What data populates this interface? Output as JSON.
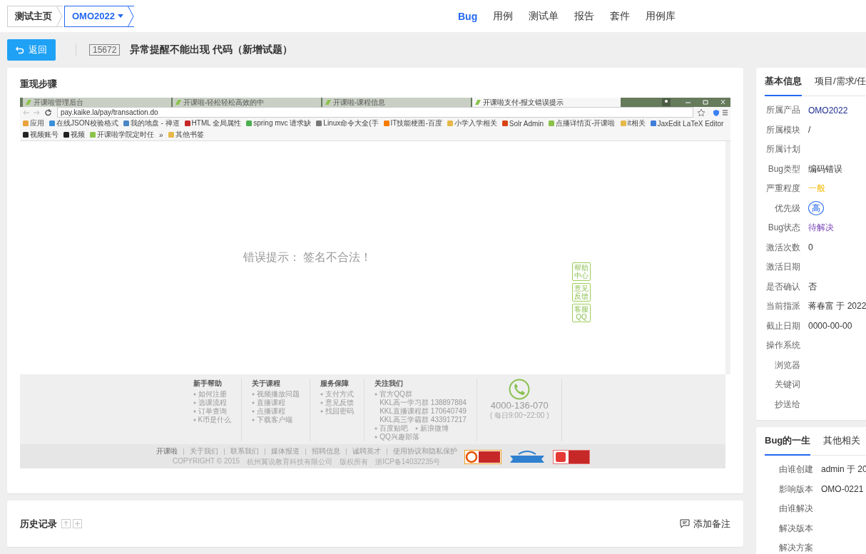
{
  "breadcrumb": [
    {
      "label": "测试主页",
      "selected": false
    },
    {
      "label": "OMO2022",
      "selected": true
    }
  ],
  "nav": [
    {
      "label": "Bug",
      "selected": true
    },
    {
      "label": "用例",
      "selected": false
    },
    {
      "label": "测试单",
      "selected": false
    },
    {
      "label": "报告",
      "selected": false
    },
    {
      "label": "套件",
      "selected": false
    },
    {
      "label": "用例库",
      "selected": false
    }
  ],
  "header": {
    "back_button": "返回",
    "bug_id": "15672",
    "title": "异常提醒不能出现 代码（新增试题）"
  },
  "steps": {
    "title": "重现步骤",
    "screenshot": {
      "tabs": [
        {
          "title": "开课啦管理后台",
          "selected": false
        },
        {
          "title": "开课啦-轻松轻松高效的中",
          "selected": false
        },
        {
          "title": "开课啦-课程信息",
          "selected": false
        },
        {
          "title": "开课啦支付-报文错误提示",
          "selected": true
        }
      ],
      "url": "pay.kaike.la/pay/transaction.do",
      "bookmarks": [
        "应用",
        "在线JSON校验格式",
        "我的地盘 - 禅道",
        "HTML 全局属性",
        "spring mvc 请求缺",
        "Linux命令大全(手",
        "IT技能梗图-百度",
        "小学入学相关",
        "Solr Admin",
        "点播详情页-开课啦",
        "it相关",
        "JaxEdit LaTeX Editor",
        "视频账号",
        "视频",
        "开课啦学院定时任",
        "»",
        "其他书签"
      ],
      "error_text": "错误提示： 签名不合法！",
      "side_buttons": [
        "帮助中心",
        "意见反馈",
        "客服QQ"
      ],
      "footer_columns": [
        {
          "title": "新手帮助",
          "items": [
            {
              "text": "如何注册",
              "kind": "bullet"
            },
            {
              "text": "选课流程",
              "kind": "bullet"
            },
            {
              "text": "订单查询",
              "kind": "bullet"
            },
            {
              "text": "K币是什么",
              "kind": "bullet"
            }
          ]
        },
        {
          "title": "关于课程",
          "items": [
            {
              "text": "视频播放问题",
              "kind": "bullet"
            },
            {
              "text": "直播课程",
              "kind": "bullet"
            },
            {
              "text": "点播课程",
              "kind": "bullet"
            },
            {
              "text": "下载客户端",
              "kind": "bullet"
            }
          ]
        },
        {
          "title": "服务保障",
          "items": [
            {
              "text": "支付方式",
              "kind": "bullet"
            },
            {
              "text": "意见反馈",
              "kind": "bullet"
            },
            {
              "text": "找回密码",
              "kind": "bullet"
            }
          ]
        },
        {
          "title": "关注我们",
          "items": [
            {
              "text": "官方QQ群",
              "kind": "bullet"
            },
            {
              "text": "KKL高一学习群 138897884",
              "kind": "sub"
            },
            {
              "text": "KKL直播课程群 170640749",
              "kind": "sub"
            },
            {
              "text": "KKL高三学霸群 433917217",
              "kind": "sub"
            },
            {
              "text": "百度贴吧",
              "kind": "inline"
            },
            {
              "text": "新浪微博",
              "kind": "inline"
            },
            {
              "text": "QQ兴趣部落",
              "kind": "bullet"
            }
          ]
        }
      ],
      "phone": "4000-136-070",
      "hours": "( 每日9:00~22:00 )",
      "footer_links": [
        "开课啦",
        "关于我们",
        "联系我们",
        "媒体报道",
        "招聘信息",
        "诚聘英才",
        "使用协议和隐私保护"
      ],
      "copyright": [
        "COPYRIGHT © 2015",
        "杭州翼说教育科技有限公司",
        "版权所有",
        "浙ICP备14032235号"
      ]
    }
  },
  "history": {
    "title": "历史记录",
    "add_note": "添加备注"
  },
  "info_tabs": [
    {
      "label": "基本信息",
      "selected": true
    },
    {
      "label": "项目/需求/任",
      "selected": false
    }
  ],
  "info": [
    {
      "label": "所属产品",
      "value": "OMO2022",
      "kind": "link"
    },
    {
      "label": "所属模块",
      "value": "/",
      "kind": "text"
    },
    {
      "label": "所属计划"
    },
    {
      "label": "Bug类型",
      "value": "编码错误",
      "kind": "text"
    },
    {
      "label": "严重程度",
      "value": "一般",
      "kind": "severity"
    },
    {
      "label": "优先级",
      "value": "高",
      "kind": "priority"
    },
    {
      "label": "Bug状态",
      "value": "待解决",
      "kind": "status"
    },
    {
      "label": "激活次数",
      "value": "0",
      "kind": "text"
    },
    {
      "label": "激活日期"
    },
    {
      "label": "是否确认",
      "value": "否",
      "kind": "text"
    },
    {
      "label": "当前指派",
      "value": "蒋春富 于 2022",
      "kind": "text"
    },
    {
      "label": "截止日期",
      "value": "0000-00-00",
      "kind": "text"
    },
    {
      "label": "操作系统"
    },
    {
      "label": "浏览器"
    },
    {
      "label": "关键词"
    },
    {
      "label": "抄送给"
    }
  ],
  "life_tabs": [
    {
      "label": "Bug的一生",
      "selected": true
    },
    {
      "label": "其他相关",
      "selected": false
    }
  ],
  "life": [
    {
      "label": "由谁创建",
      "value": "admin 于 20",
      "kind": "text"
    },
    {
      "label": "影响版本",
      "value": "OMO-0221",
      "kind": "text"
    },
    {
      "label": "由谁解决"
    },
    {
      "label": "解决版本"
    },
    {
      "label": "解决方案"
    }
  ]
}
